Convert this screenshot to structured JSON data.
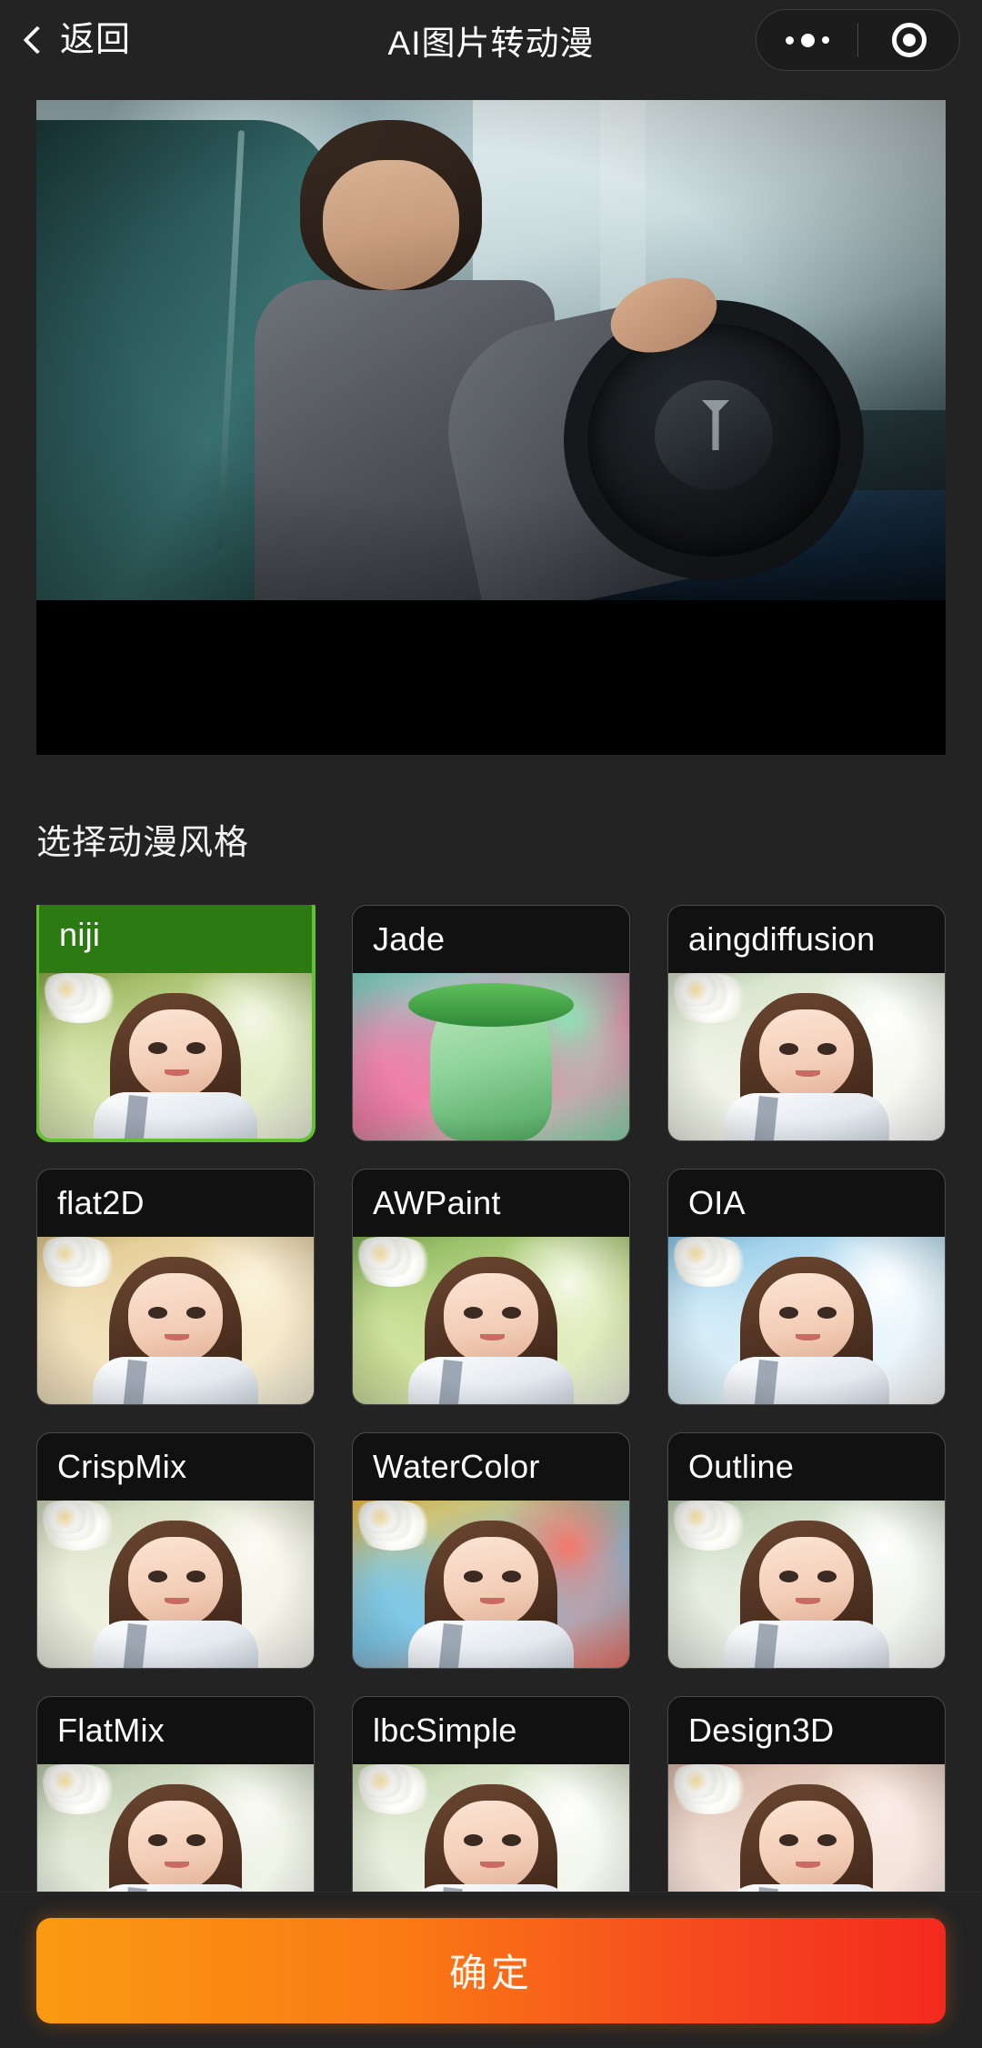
{
  "navbar": {
    "back_label": "返回",
    "back_icon": "chevron-left-icon",
    "title": "AI图片转动漫",
    "capsule": {
      "more_icon": "more-dots-icon",
      "close_icon": "target-circle-icon"
    }
  },
  "preview": {
    "alt": "uploaded-photo-man-in-car",
    "letterbox_color": "#000000"
  },
  "section": {
    "title": "选择动漫风格"
  },
  "styles": [
    {
      "name": "niji",
      "selected": true,
      "thumb": "girl-white-flowers-green"
    },
    {
      "name": "Jade",
      "selected": false,
      "thumb": "jade-statue-pink-flowers"
    },
    {
      "name": "aingdiffusion",
      "selected": false,
      "thumb": "girl-white-flowers-soft"
    },
    {
      "name": "flat2D",
      "selected": false,
      "thumb": "girl-flowers-warm-beige"
    },
    {
      "name": "AWPaint",
      "selected": false,
      "thumb": "girl-flowers-green-paint"
    },
    {
      "name": "OIA",
      "selected": false,
      "thumb": "girl-flowers-blue-sky"
    },
    {
      "name": "CrispMix",
      "selected": false,
      "thumb": "girl-flowers-pastel"
    },
    {
      "name": "WaterColor",
      "selected": false,
      "thumb": "girl-flowers-watercolor"
    },
    {
      "name": "Outline",
      "selected": false,
      "thumb": "girl-flowers-outline"
    },
    {
      "name": "FlatMix",
      "selected": false,
      "thumb": "girl-flowers-flatmix"
    },
    {
      "name": "lbcSimple",
      "selected": false,
      "thumb": "girl-flowers-simple"
    },
    {
      "name": "Design3D",
      "selected": false,
      "thumb": "girl-flowers-3d"
    }
  ],
  "footer": {
    "confirm_label": "确定"
  },
  "colors": {
    "background": "#232323",
    "card_background": "#111111",
    "card_border": "#4a4a4a",
    "selected_green": "#2c7a12",
    "selected_border": "#62c12e",
    "text_primary": "#ffffff",
    "confirm_gradient_start": "#fa9a12",
    "confirm_gradient_end": "#f32a1e"
  }
}
